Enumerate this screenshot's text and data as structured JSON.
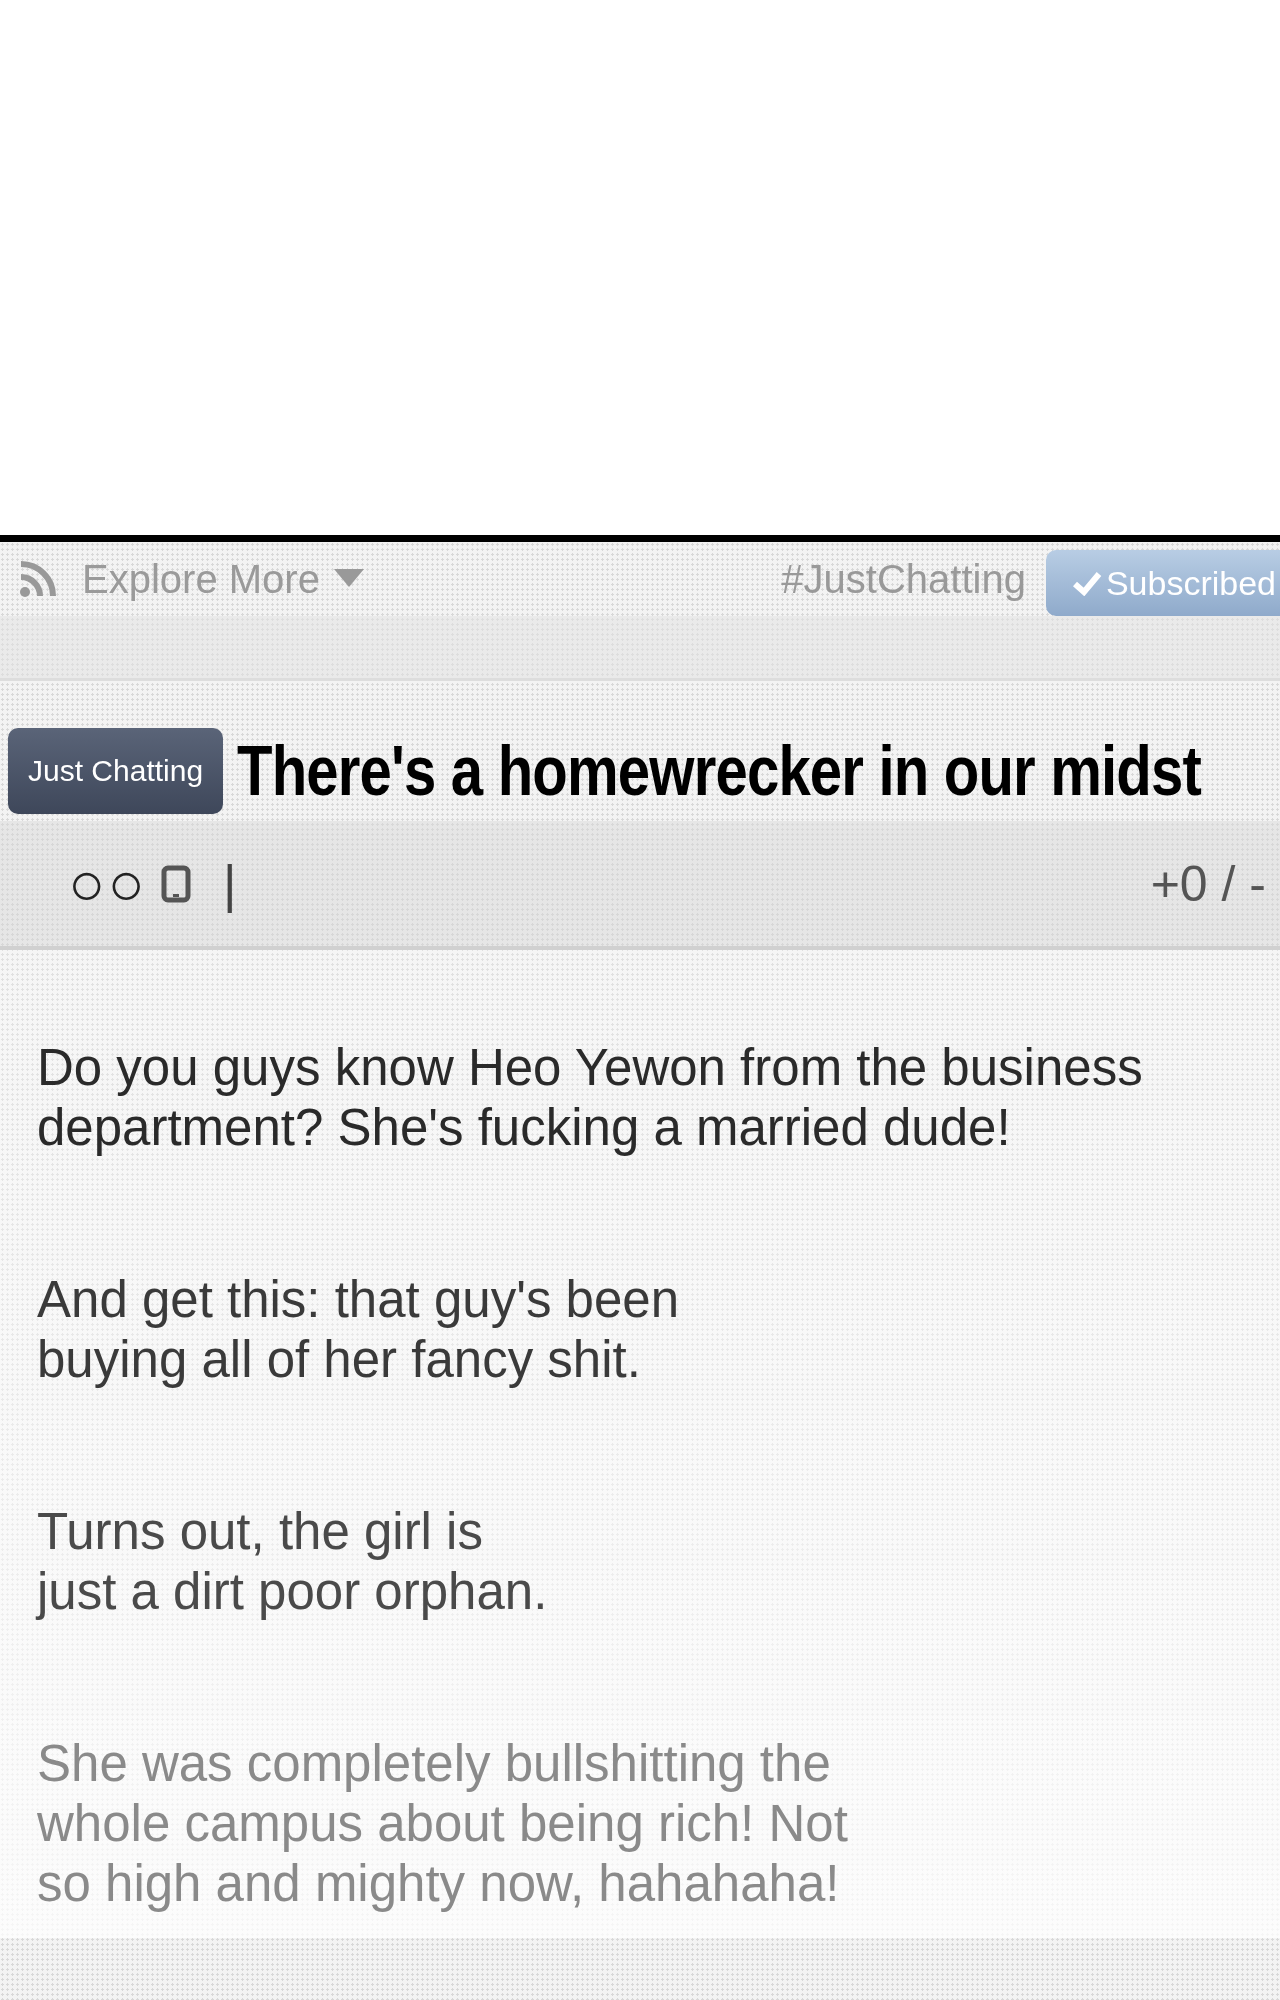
{
  "header": {
    "feed_label": "Explore More",
    "hashtag": "#JustChatting",
    "subscribe_button": {
      "label": "Subscribed",
      "subscribed": true
    }
  },
  "post": {
    "category": "Just Chatting",
    "title": "There's a homewrecker in our midst"
  },
  "toolbar": {
    "circles": "○○",
    "separator": "|",
    "score": "+0 / -"
  },
  "paragraphs": [
    {
      "lines": [
        "Do you guys know Heo Yewon from the business",
        "department? She's fucking a married dude!"
      ]
    },
    {
      "lines": [
        "And get this: that guy's been",
        "buying all of her fancy shit."
      ]
    },
    {
      "lines": [
        "Turns out, the girl is",
        "just a dirt poor orphan."
      ]
    },
    {
      "lines": [
        "She was completely bullshitting the",
        "whole campus about being rich! Not",
        "so high and mighty now, hahahaha!"
      ]
    }
  ]
}
